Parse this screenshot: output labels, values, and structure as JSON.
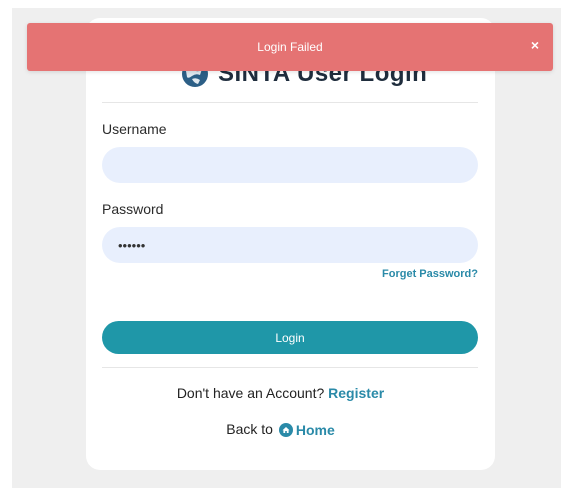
{
  "toast": {
    "message": "Login Failed",
    "close_glyph": "×",
    "color": "#e57373"
  },
  "card": {
    "title": "SINTA User Login",
    "logo_icon": "globe-logo-icon"
  },
  "form": {
    "username_label": "Username",
    "username_value": "",
    "password_label": "Password",
    "password_value": "••••••",
    "forget_password_link": "Forget Password?",
    "login_button": "Login"
  },
  "footer": {
    "no_account_text": "Don't have an Account?",
    "register_link": "Register",
    "back_to_text": "Back to",
    "home_link": "Home",
    "home_icon": "home-icon"
  },
  "colors": {
    "accent": "#1f97a8",
    "link": "#2a8aa8",
    "input_bg": "#e8effd"
  }
}
